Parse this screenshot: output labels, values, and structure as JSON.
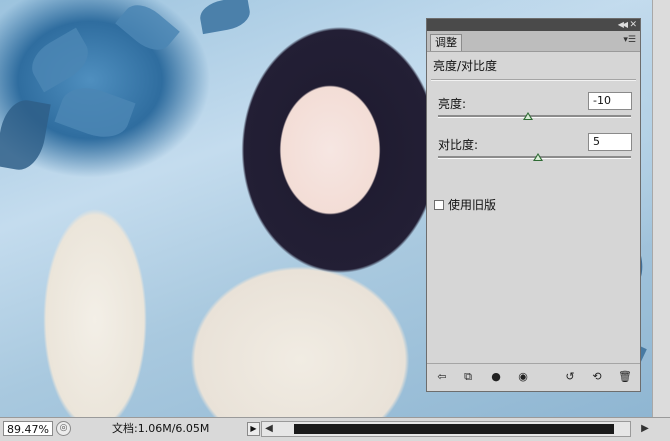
{
  "panel": {
    "tab_label": "调整",
    "title": "亮度/对比度",
    "brightness": {
      "label": "亮度:",
      "value": "-10",
      "level": -10
    },
    "contrast": {
      "label": "对比度:",
      "value": "5",
      "level": 5
    },
    "slider_range": [
      -150,
      150
    ],
    "legacy": {
      "label": "使用旧版",
      "checked": false
    },
    "footer_icons": [
      "back-arrow-icon",
      "expand-view-icon",
      "clip-to-layer-icon",
      "visibility-eye-icon",
      "view-previous-icon",
      "reset-icon",
      "trash-icon"
    ]
  },
  "status": {
    "zoom": "89.47%",
    "doc_info": "文档:1.06M/6.05M"
  },
  "colors": {
    "panel_bg": "#d6d6d6",
    "slider_thumb": "#2f6b34",
    "scroll_thumb": "#1a1a1a"
  }
}
